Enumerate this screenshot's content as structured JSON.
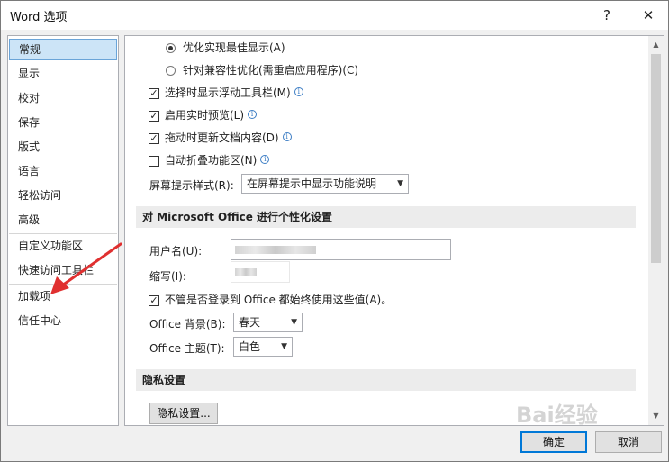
{
  "window": {
    "title": "Word 选项",
    "help_label": "?",
    "close_label": "✕"
  },
  "sidebar": {
    "items": [
      {
        "label": "常规",
        "selected": true
      },
      {
        "label": "显示"
      },
      {
        "label": "校对"
      },
      {
        "label": "保存"
      },
      {
        "label": "版式"
      },
      {
        "label": "语言"
      },
      {
        "label": "轻松访问"
      },
      {
        "label": "高级"
      },
      {
        "label": "自定义功能区"
      },
      {
        "label": "快速访问工具栏"
      },
      {
        "label": "加载项"
      },
      {
        "label": "信任中心"
      }
    ]
  },
  "ui_options": {
    "radio_best_display": "优化实现最佳显示(A)",
    "radio_compat": "针对兼容性优化(需重启应用程序)(C)",
    "cb_float_toolbar": "选择时显示浮动工具栏(M)",
    "cb_live_preview": "启用实时预览(L)",
    "cb_update_drag": "拖动时更新文档内容(D)",
    "cb_collapse_ribbon": "自动折叠功能区(N)",
    "tooltip_style_label": "屏幕提示样式(R):",
    "tooltip_style_value": "在屏幕提示中显示功能说明",
    "check_mark": "✓",
    "info_glyph": "i"
  },
  "personalize": {
    "heading": "对 Microsoft Office 进行个性化设置",
    "username_label": "用户名(U):",
    "initials_label": "缩写(I):",
    "always_use_label": "不管是否登录到 Office 都始终使用这些值(A)。",
    "background_label": "Office 背景(B):",
    "background_value": "春天",
    "theme_label": "Office 主题(T):",
    "theme_value": "白色"
  },
  "privacy": {
    "heading": "隐私设置",
    "button_label": "隐私设置..."
  },
  "footer": {
    "ok_label": "确定",
    "cancel_label": "取消"
  },
  "watermark": {
    "brand": "Bai经验",
    "sub": "经验"
  },
  "colors": {
    "selection": "#cce4f7",
    "annotation_arrow": "#e03030",
    "primary_border": "#0078d7"
  }
}
